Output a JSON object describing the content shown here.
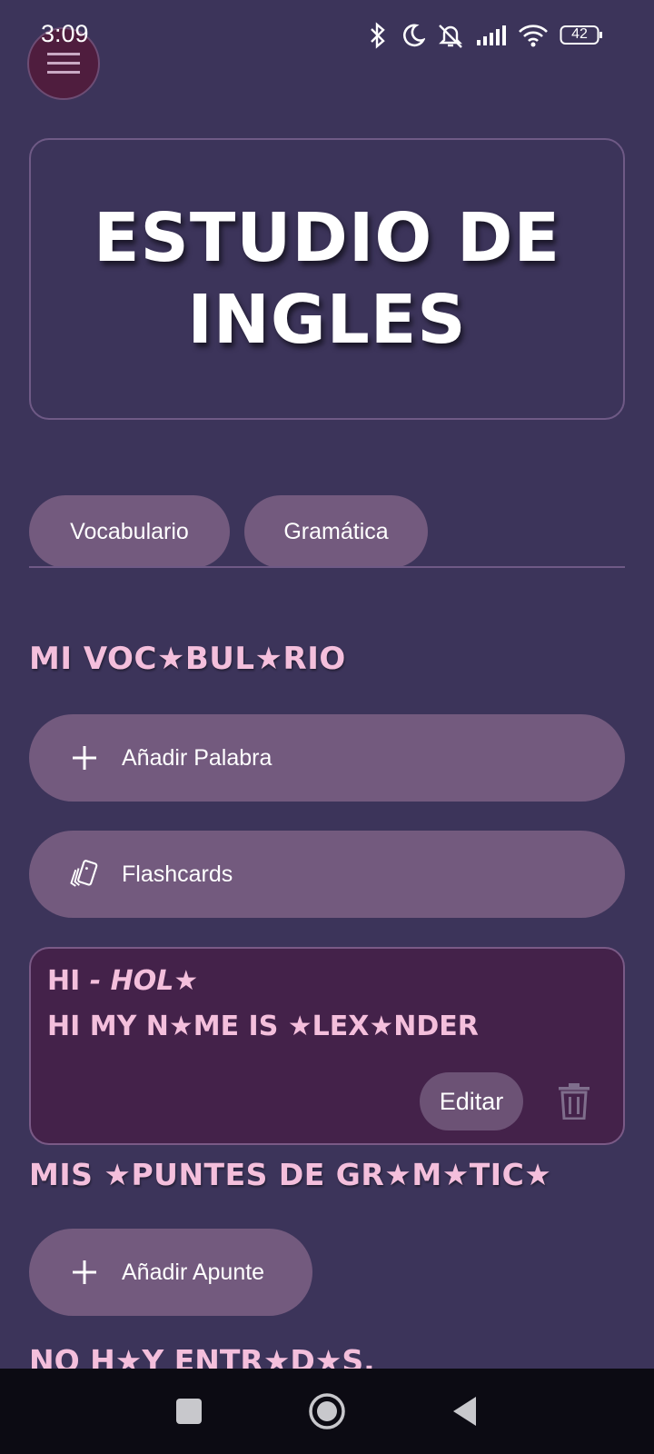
{
  "status_bar": {
    "time": "3:09",
    "battery": "42",
    "icons": [
      "bluetooth-icon",
      "moon-icon",
      "bell-off-icon",
      "signal-icon",
      "wifi-icon",
      "battery-icon"
    ]
  },
  "menu": {
    "icon": "hamburger-icon"
  },
  "header": {
    "title": "ESTUDIO DE INGLES"
  },
  "tabs": [
    {
      "label": "Vocabulario"
    },
    {
      "label": "Gramática"
    }
  ],
  "vocabulary": {
    "heading": "MI VOC★BUL★RIO",
    "add_button": {
      "label": "Añadir Palabra",
      "icon": "plus-icon"
    },
    "flashcards_button": {
      "label": "Flashcards",
      "icon": "cards-icon"
    },
    "entries": [
      {
        "word": "HI",
        "separator": " - ",
        "translation": "HOL★",
        "example": "HI MY N★ME IS ★LEX★NDER",
        "edit_label": "Editar",
        "delete_icon": "trash-icon"
      }
    ]
  },
  "grammar": {
    "heading": "MIS ★PUNTES DE GR★M★TIC★",
    "add_button": {
      "label": "Añadir Apunte",
      "icon": "plus-icon"
    },
    "empty_text": "NO H★Y ENTR★D★S."
  },
  "nav_bar": {
    "buttons": [
      "recents-icon",
      "home-icon",
      "back-icon"
    ]
  },
  "colors": {
    "background": "#3c345a",
    "pill": "#735a7e",
    "card": "#44224a",
    "accent_pink": "#f4bfdc",
    "menu_button": "#4f1d3e"
  }
}
